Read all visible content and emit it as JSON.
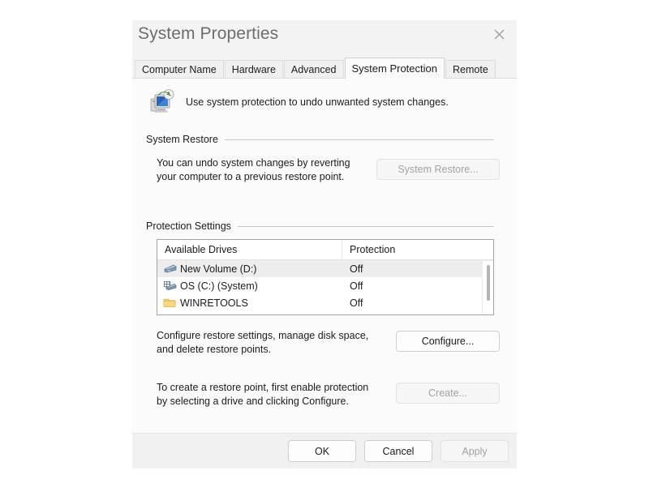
{
  "window": {
    "title": "System Properties",
    "close_icon": "close-icon"
  },
  "tabs": [
    {
      "label": "Computer Name",
      "active": false
    },
    {
      "label": "Hardware",
      "active": false
    },
    {
      "label": "Advanced",
      "active": false
    },
    {
      "label": "System Protection",
      "active": true
    },
    {
      "label": "Remote",
      "active": false
    }
  ],
  "intro": {
    "icon": "system-protection-icon",
    "text": "Use system protection to undo unwanted system changes."
  },
  "system_restore": {
    "group_label": "System Restore",
    "description": "You can undo system changes by reverting\nyour computer to a previous restore point.",
    "button_label": "System Restore...",
    "button_enabled": false
  },
  "protection_settings": {
    "group_label": "Protection Settings",
    "columns": [
      "Available Drives",
      "Protection"
    ],
    "rows": [
      {
        "icon": "drive-icon",
        "name": "New Volume (D:)",
        "protection": "Off",
        "selected": true
      },
      {
        "icon": "system-drive-icon",
        "name": "OS (C:) (System)",
        "protection": "Off",
        "selected": false
      },
      {
        "icon": "folder-icon",
        "name": "WINRETOOLS",
        "protection": "Off",
        "selected": false
      }
    ],
    "configure": {
      "description": "Configure restore settings, manage disk space,\nand delete restore points.",
      "button_label": "Configure...",
      "button_enabled": true
    },
    "create": {
      "description": "To create a restore point, first enable protection\nby selecting a drive and clicking Configure.",
      "button_label": "Create...",
      "button_enabled": false
    }
  },
  "footer": {
    "ok_label": "OK",
    "cancel_label": "Cancel",
    "apply_label": "Apply",
    "apply_enabled": false
  },
  "colors": {
    "dialog_bg": "#f3f3f3",
    "panel_bg": "#fbfbfb",
    "selected_row": "#ededed",
    "folder_yellow": "#f7ca61",
    "drive_blue": "#5b86ad"
  }
}
